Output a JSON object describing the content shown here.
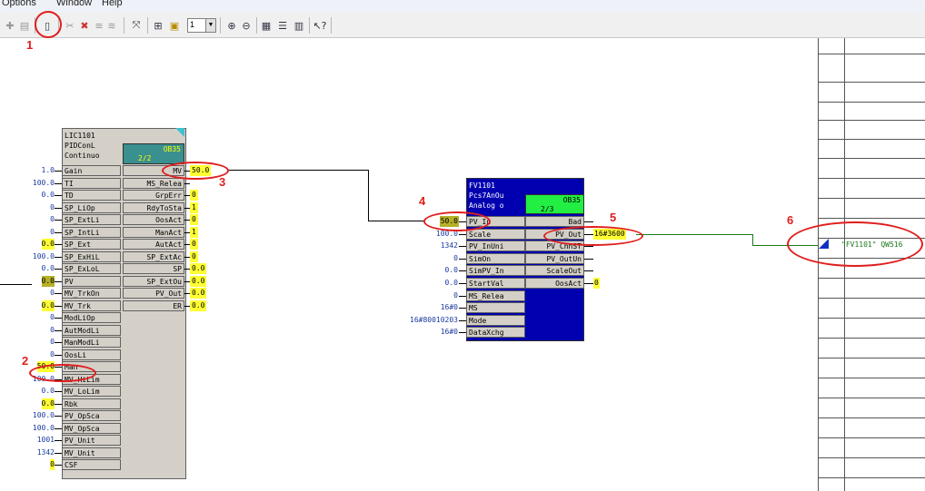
{
  "menu": {
    "options": "Options",
    "window": "Window",
    "help": "Help"
  },
  "toolbar": {
    "icons": [
      "clear-icon",
      "paste-icon",
      "insert-block-icon",
      "delete-icon",
      "cut-icon",
      "copy-icon",
      "fit-icon",
      "grid-icon",
      "window-icon",
      "zoom-in-icon",
      "zoom-out-icon",
      "network-icon",
      "list-icon",
      "window-split-icon",
      "help-icon"
    ],
    "sheet_select": "1"
  },
  "annotations": {
    "n1": "1",
    "n2": "2",
    "n3": "3",
    "n4": "4",
    "n5": "5",
    "n6": "6"
  },
  "lic": {
    "line1": "LIC1101",
    "line2": "PIDConL",
    "line3": "Continuo",
    "ob": "OB35",
    "ob_run": "2/2",
    "inputs": [
      {
        "pin": "Gain",
        "value": "1.0"
      },
      {
        "pin": "TI",
        "value": "100.0"
      },
      {
        "pin": "TD",
        "value": "0.0"
      },
      {
        "pin": "SP_LiOp",
        "value": "0"
      },
      {
        "pin": "SP_ExtLi",
        "value": "0"
      },
      {
        "pin": "SP_IntLi",
        "value": "0"
      },
      {
        "pin": "SP_Ext",
        "value": "0.0"
      },
      {
        "pin": "SP_ExHiL",
        "value": "100.0"
      },
      {
        "pin": "SP_ExLoL",
        "value": "0.0"
      },
      {
        "pin": "PV",
        "value": "0.0"
      },
      {
        "pin": "MV_TrkOn",
        "value": "0"
      },
      {
        "pin": "MV_Trk",
        "value": "0.0"
      },
      {
        "pin": "ModLiOp",
        "value": "0"
      },
      {
        "pin": "AutModLi",
        "value": "0"
      },
      {
        "pin": "ManModLi",
        "value": "0"
      },
      {
        "pin": "OosLi",
        "value": "0"
      },
      {
        "pin": "Man",
        "value": "50.0"
      },
      {
        "pin": "MV_HiLim",
        "value": "100.0"
      },
      {
        "pin": "MV_LoLim",
        "value": "0.0"
      },
      {
        "pin": "Rbk",
        "value": "0.0"
      },
      {
        "pin": "PV_OpSca",
        "value": "100.0"
      },
      {
        "pin": "MV_OpSca",
        "value": "100.0"
      },
      {
        "pin": "PV_Unit",
        "value": "1001"
      },
      {
        "pin": "MV_Unit",
        "value": "1342"
      },
      {
        "pin": "CSF",
        "value": "0"
      }
    ],
    "outputs": [
      {
        "pin": "MV",
        "value": "50.0"
      },
      {
        "pin": "MS_Relea",
        "value": ""
      },
      {
        "pin": "GrpErr",
        "value": "0"
      },
      {
        "pin": "RdyToSta",
        "value": "1"
      },
      {
        "pin": "OosAct",
        "value": "0"
      },
      {
        "pin": "ManAct",
        "value": "1"
      },
      {
        "pin": "AutAct",
        "value": "0"
      },
      {
        "pin": "SP_ExtAc",
        "value": "0"
      },
      {
        "pin": "SP",
        "value": "0.0"
      },
      {
        "pin": "SP_ExtOu",
        "value": "0.0"
      },
      {
        "pin": "PV_Out",
        "value": "0.0"
      },
      {
        "pin": "ER",
        "value": "0.0"
      }
    ]
  },
  "fv": {
    "line1": "FV1101",
    "line2": "Pcs7AnOu",
    "line3": "Analog o",
    "ob": "OB35",
    "ob_run": "2/3",
    "inputs": [
      {
        "pin": "PV_In",
        "value": "50.0"
      },
      {
        "pin": "Scale",
        "value": "100.0"
      },
      {
        "pin": "PV_InUni",
        "value": "1342"
      },
      {
        "pin": "SimOn",
        "value": "0"
      },
      {
        "pin": "SimPV_In",
        "value": "0.0"
      },
      {
        "pin": "StartVal",
        "value": "0.0"
      },
      {
        "pin": "MS_Relea",
        "value": "0"
      },
      {
        "pin": "MS",
        "value": "16#0"
      },
      {
        "pin": "Mode",
        "value": "16#80010203"
      },
      {
        "pin": "DataXchg",
        "value": "16#0"
      }
    ],
    "outputs": [
      {
        "pin": "Bad",
        "value": ""
      },
      {
        "pin": "PV_Out",
        "value": "16#3600"
      },
      {
        "pin": "PV_ChnST",
        "value": ""
      },
      {
        "pin": "PV_OutUn",
        "value": ""
      },
      {
        "pin": "ScaleOut",
        "value": ""
      },
      {
        "pin": "OosAct",
        "value": "0"
      }
    ]
  },
  "address": {
    "label": "\"FV1101\" QW516"
  }
}
